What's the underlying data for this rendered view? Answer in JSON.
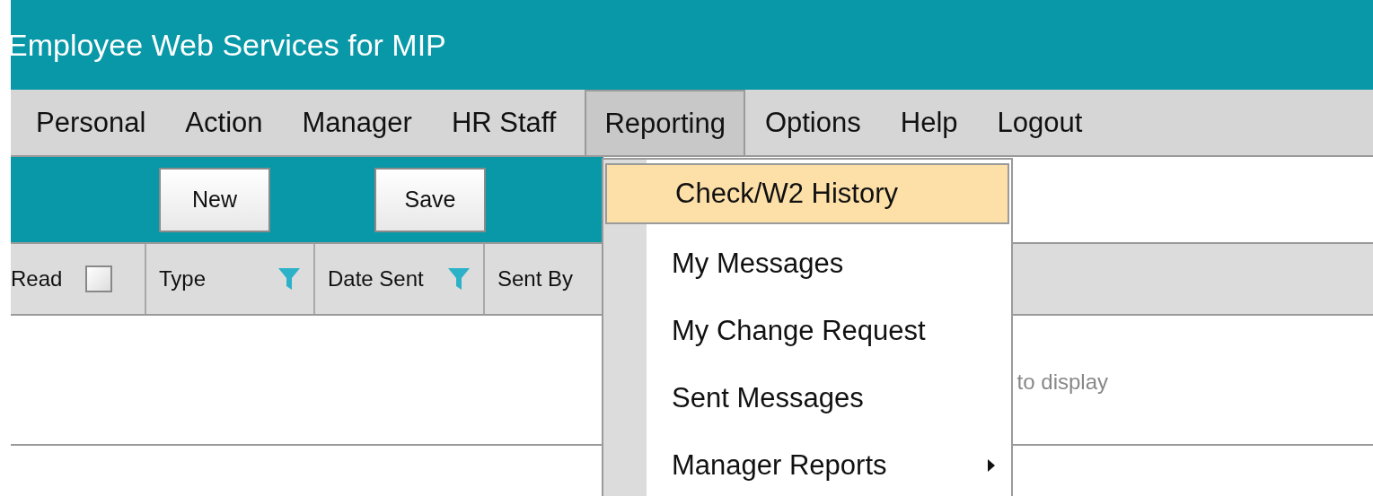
{
  "title": "Employee Web Services for MIP",
  "nav": [
    {
      "label": "Personal",
      "selected": false
    },
    {
      "label": "Action",
      "selected": false
    },
    {
      "label": "Manager",
      "selected": false
    },
    {
      "label": "HR Staff",
      "selected": false
    },
    {
      "label": "Reporting",
      "selected": true
    },
    {
      "label": "Options",
      "selected": false
    },
    {
      "label": "Help",
      "selected": false
    },
    {
      "label": "Logout",
      "selected": false
    }
  ],
  "toolbar": {
    "buttons": [
      "New",
      "Save"
    ]
  },
  "table": {
    "columns": [
      {
        "label": "Read",
        "kind": "checkbox",
        "checked": false
      },
      {
        "label": "Type",
        "kind": "filter"
      },
      {
        "label": "Date Sent",
        "kind": "filter"
      },
      {
        "label": "Sent By",
        "kind": "plain"
      }
    ],
    "empty_message": "to display"
  },
  "dropdown": {
    "items": [
      {
        "label": "Check/W2 History",
        "selected": true,
        "submenu": false
      },
      {
        "label": "My Messages",
        "selected": false,
        "submenu": false
      },
      {
        "label": "My Change Request",
        "selected": false,
        "submenu": false
      },
      {
        "label": "Sent Messages",
        "selected": false,
        "submenu": false
      },
      {
        "label": "Manager Reports",
        "selected": false,
        "submenu": true
      }
    ]
  }
}
